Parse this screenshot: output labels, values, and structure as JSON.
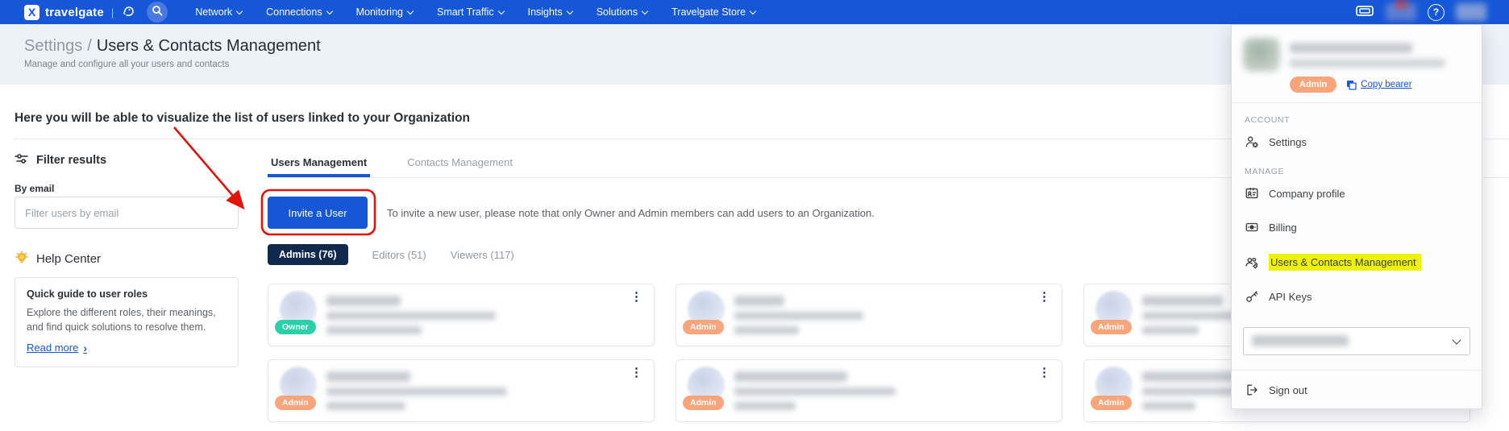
{
  "colors": {
    "navbar_blue": "#1657d8",
    "accent_blue": "#1a56db",
    "active_pill_navy": "#12294e",
    "owner_badge": "#2bd0a9",
    "admin_badge": "#f8a57c",
    "menu_highlight_yellow": "#eef207",
    "annotation_red": "#e3120b"
  },
  "navbar": {
    "logo_letter": "X",
    "brand": "travelgate",
    "brand_sep": "|",
    "items": [
      {
        "label": "Network"
      },
      {
        "label": "Connections"
      },
      {
        "label": "Monitoring"
      },
      {
        "label": "Smart Traffic"
      },
      {
        "label": "Insights"
      },
      {
        "label": "Solutions"
      },
      {
        "label": "Travelgate Store"
      }
    ],
    "help_label": "?"
  },
  "header": {
    "breadcrumb_parent": "Settings",
    "breadcrumb_sep": "/",
    "title": "Users & Contacts Management",
    "subtitle": "Manage and configure all your users and contacts"
  },
  "main": {
    "intro": "Here you will be able to visualize the list of users linked to your Organization",
    "tabs": [
      {
        "label": "Users Management"
      },
      {
        "label": "Contacts Management"
      }
    ],
    "invite_button": "Invite a User",
    "invite_note": "To invite a new user, please note that only Owner and Admin members can add users to an Organization.",
    "role_filters": [
      {
        "label": "Admins (76)"
      },
      {
        "label": "Editors (51)"
      },
      {
        "label": "Viewers (117)"
      }
    ],
    "cards": [
      {
        "role": "Owner"
      },
      {
        "role": "Admin"
      },
      {
        "role": "Admin"
      },
      {
        "role": "Admin"
      },
      {
        "role": "Admin"
      },
      {
        "role": "Admin"
      }
    ],
    "kebab_glyph": "⋮"
  },
  "filter_panel": {
    "title": "Filter results",
    "by_email_label": "By email",
    "email_placeholder": "Filter users by email"
  },
  "help_center": {
    "title": "Help Center",
    "card_title": "Quick guide to user roles",
    "card_body": "Explore the different roles, their meanings, and find quick solutions to resolve them.",
    "read_more": "Read more",
    "read_more_arrow": "›"
  },
  "account_menu": {
    "role_badge": "Admin",
    "copy_bearer": "Copy bearer",
    "sections": [
      {
        "label": "ACCOUNT",
        "items": [
          {
            "label": "Settings"
          }
        ]
      },
      {
        "label": "MANAGE",
        "items": [
          {
            "label": "Company profile"
          },
          {
            "label": "Billing"
          },
          {
            "label": "Users & Contacts Management"
          },
          {
            "label": "API Keys"
          }
        ]
      }
    ],
    "sign_out": "Sign out"
  }
}
